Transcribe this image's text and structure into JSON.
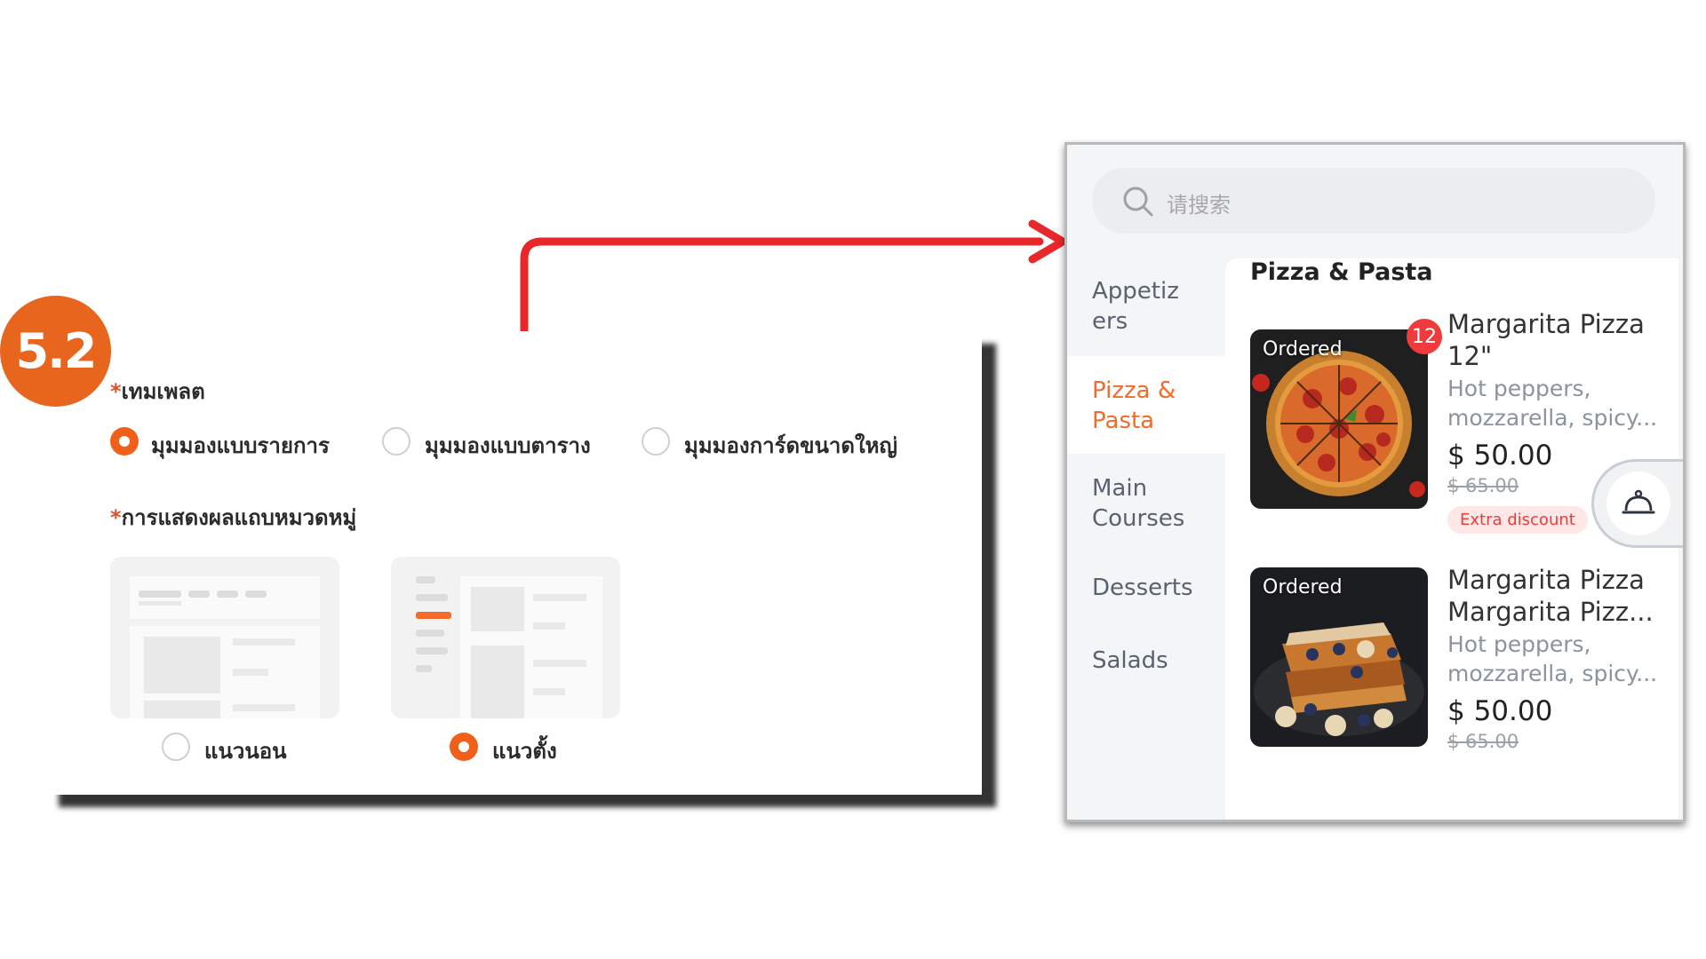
{
  "step_badge": "5.2",
  "settings": {
    "template_label": "เทมเพลต",
    "required_mark": "*",
    "template_options": [
      {
        "label": "มุมมองแบบรายการ",
        "selected": true
      },
      {
        "label": "มุมมองแบบตาราง",
        "selected": false
      },
      {
        "label": "มุมมองการ์ดขนาดใหญ่",
        "selected": false
      }
    ],
    "category_display_label": "การแสดงผลแถบหมวดหมู่",
    "category_display_options": [
      {
        "label": "แนวนอน",
        "selected": false
      },
      {
        "label": "แนวตั้ง",
        "selected": true
      }
    ]
  },
  "preview": {
    "search_placeholder": "请搜索",
    "categories": [
      {
        "label": "Appetiz\ners",
        "active": false
      },
      {
        "label": "Pizza &\nPasta",
        "active": true
      },
      {
        "label": "Main\nCourses",
        "active": false
      },
      {
        "label": "Desserts",
        "active": false
      },
      {
        "label": "Salads",
        "active": false
      }
    ],
    "section_title": "Pizza & Pasta",
    "items": [
      {
        "ordered_tag": "Ordered",
        "count_badge": "12",
        "name_line1": "Margarita Pizza",
        "name_line2": "12\"",
        "desc_line1": "Hot peppers,",
        "desc_line2": "mozzarella, spicy...",
        "price": "$ 50.00",
        "old_price": "$ 65.00",
        "discount_tag": "Extra discount"
      },
      {
        "ordered_tag": "Ordered",
        "name_line1": "Margarita Pizza",
        "name_line2": "Margarita Pizz...",
        "desc_line1": "Hot peppers,",
        "desc_line2": "mozzarella, spicy...",
        "price": "$ 50.00",
        "old_price": "$ 65.00"
      }
    ],
    "cart_icon": "cloche-icon"
  },
  "colors": {
    "accent_orange": "#f0601a",
    "arrow_red": "#e8272b",
    "badge_red": "#ef3b3b"
  }
}
